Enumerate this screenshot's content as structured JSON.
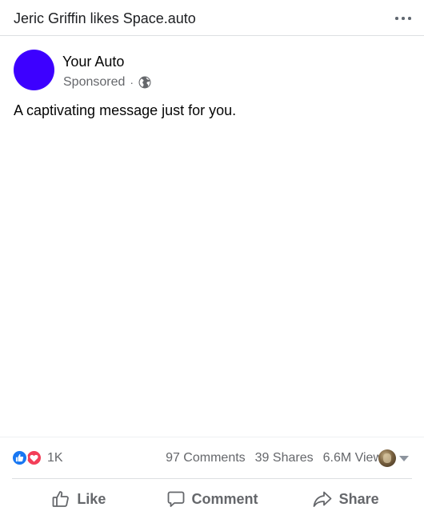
{
  "topbar": {
    "text": "Jeric Griffin likes Space.auto",
    "more_icon": "ellipsis-horizontal-icon"
  },
  "author": {
    "name": "Your Auto",
    "sponsored_label": "Sponsored",
    "separator": "·",
    "privacy_icon": "globe-icon",
    "avatar_color": "#3d00ff"
  },
  "post": {
    "message": "A captivating message just for you."
  },
  "stats": {
    "reactions": [
      "like",
      "love"
    ],
    "reaction_count": "1K",
    "comments": "97 Comments",
    "shares": "39 Shares",
    "views": "6.6M Views"
  },
  "actions": {
    "like_label": "Like",
    "comment_label": "Comment",
    "share_label": "Share"
  },
  "colors": {
    "like_blue": "#1877f2",
    "love_red": "#f33e58",
    "secondary_text": "#65676b"
  }
}
